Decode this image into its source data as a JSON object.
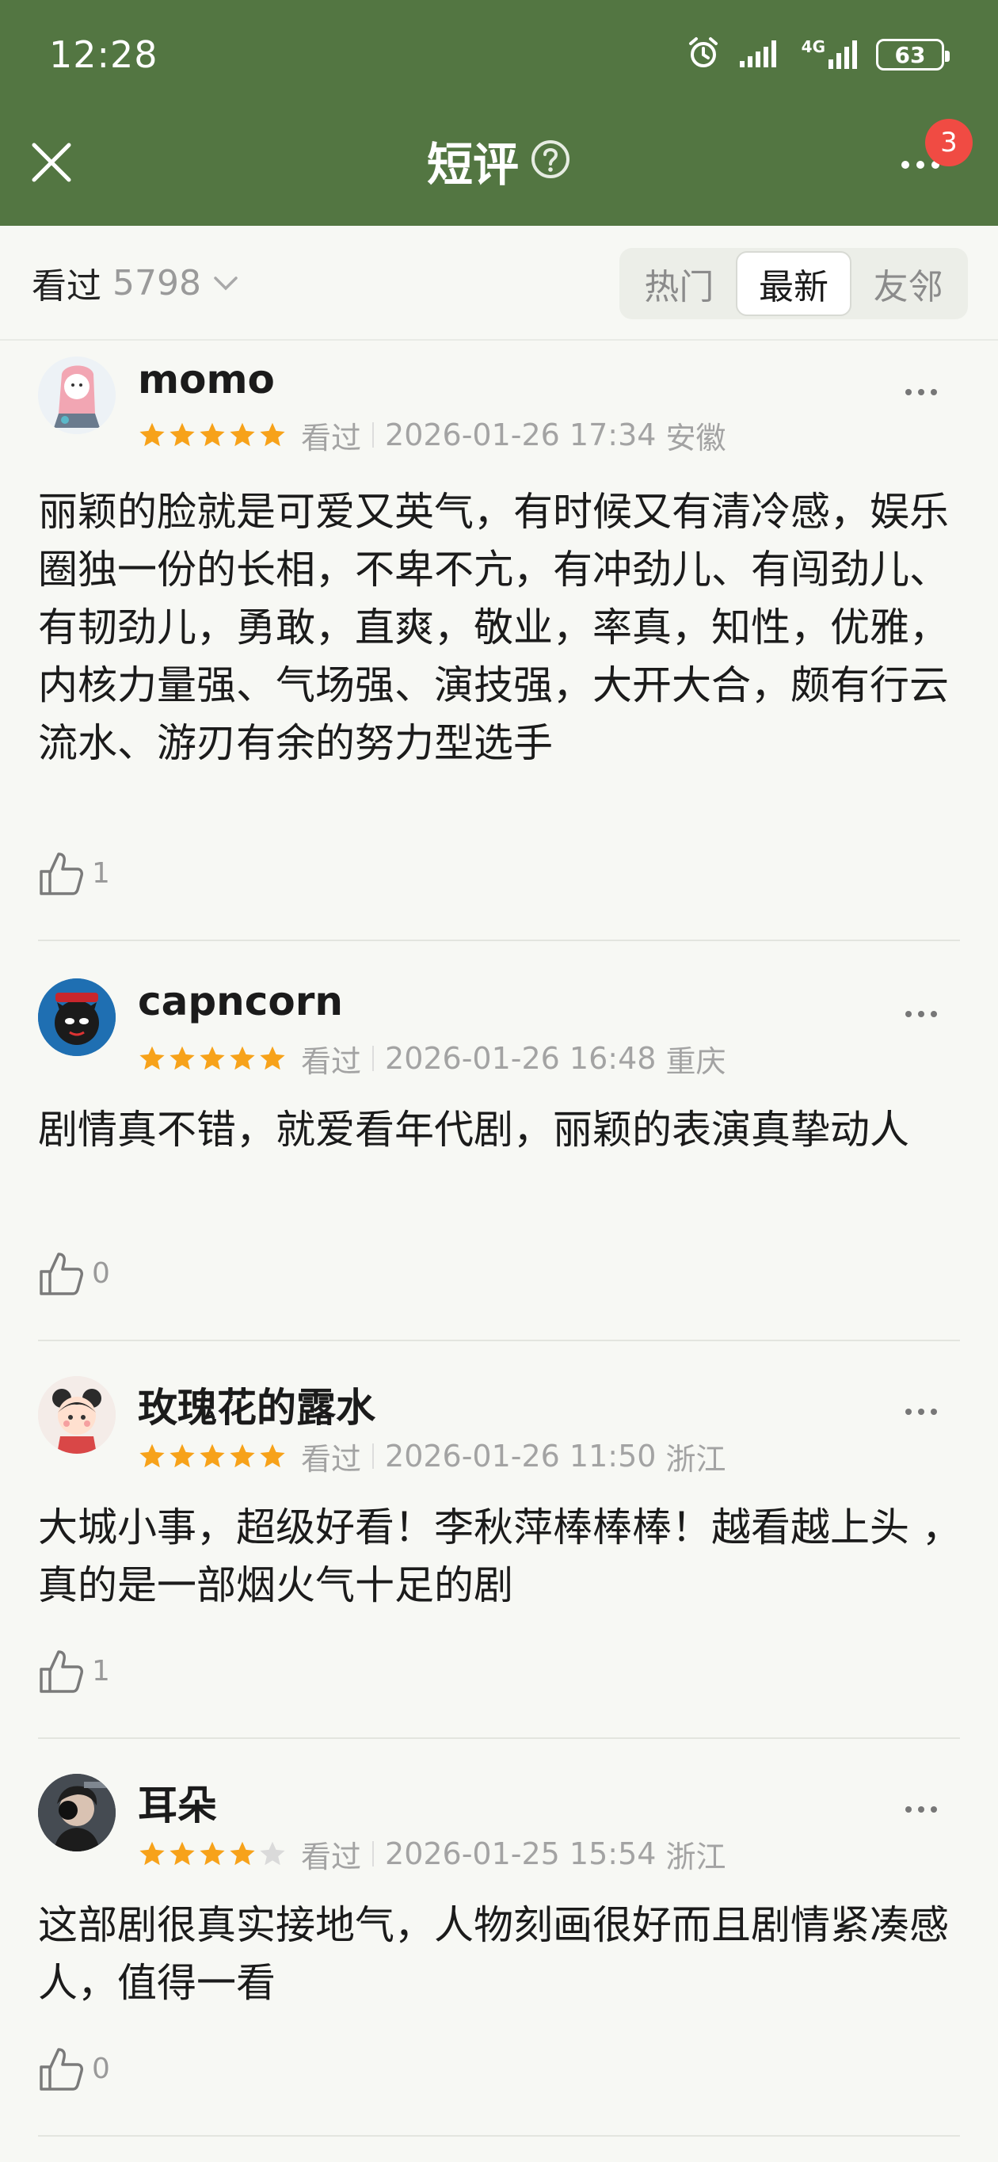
{
  "status_bar": {
    "time": "12:28",
    "battery": "63",
    "network": "4G",
    "icons": [
      "alarm-icon",
      "signal-icon",
      "signal-4g-icon",
      "battery-icon"
    ]
  },
  "nav": {
    "title": "短评",
    "badge": "3",
    "icons": [
      "close-icon",
      "help-icon",
      "more-icon"
    ]
  },
  "filter": {
    "label": "看过",
    "count": "5798",
    "tabs": [
      {
        "label": "热门",
        "active": false
      },
      {
        "label": "最新",
        "active": true
      },
      {
        "label": "友邻",
        "active": false
      }
    ]
  },
  "colors": {
    "header_bg": "#537642",
    "star": "#f7a21a",
    "badge": "#f04b43"
  },
  "reviews": [
    {
      "user": "momo",
      "rating": 5,
      "status": "看过",
      "date": "2026-01-26 17:34",
      "location": "安徽",
      "text": "丽颖的脸就是可爱又英气，有时候又有清冷感，娱乐圈独一份的长相，不卑不亢，有冲劲儿、有闯劲儿、有韧劲儿，勇敢，直爽，敬业，率真，知性，优雅，内核力量强、气场强、演技强，大开大合，颇有行云流水、游刃有余的努力型选手",
      "likes": "1"
    },
    {
      "user": "capncorn",
      "rating": 5,
      "status": "看过",
      "date": "2026-01-26 16:48",
      "location": "重庆",
      "text": "剧情真不错，就爱看年代剧，丽颖的表演真挚动人",
      "likes": "0"
    },
    {
      "user": "玫瑰花的露水",
      "rating": 5,
      "status": "看过",
      "date": "2026-01-26 11:50",
      "location": "浙江",
      "text": "大城小事，超级好看！李秋萍棒棒棒！越看越上头 ，真的是一部烟火气十足的剧",
      "likes": "1"
    },
    {
      "user": "耳朵",
      "rating": 4,
      "status": "看过",
      "date": "2026-01-25 15:54",
      "location": "浙江",
      "text": "这部剧很真实接地气，人物刻画很好而且剧情紧凑感人，值得一看",
      "likes": "0"
    }
  ]
}
